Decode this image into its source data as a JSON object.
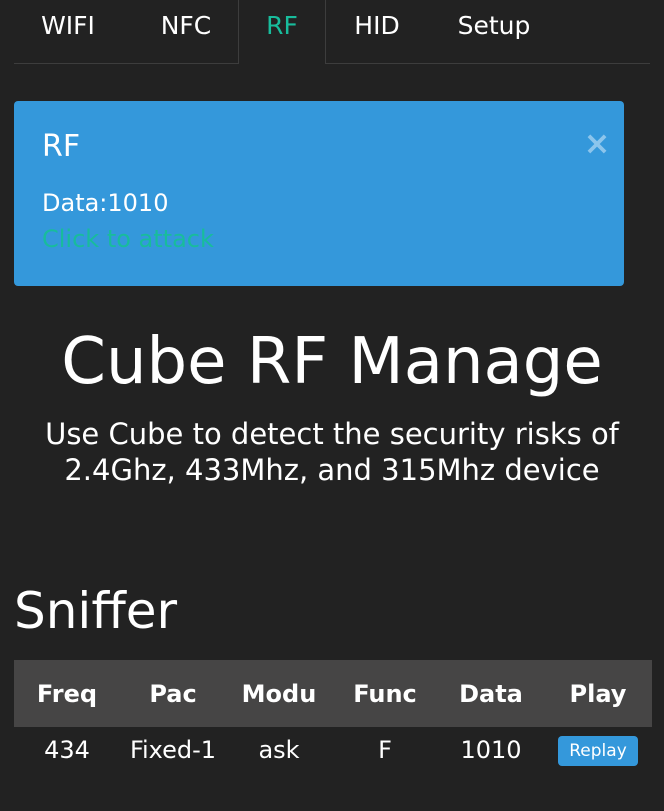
{
  "tabs": {
    "wifi": "WIFI",
    "nfc": "NFC",
    "rf": "RF",
    "hid": "HID",
    "setup": "Setup",
    "active": "RF"
  },
  "alert": {
    "title": "RF",
    "close": "×",
    "data": "Data:1010",
    "link": "Click to attack"
  },
  "hero": {
    "title": "Cube RF Manage",
    "subtitle_line1": "Use Cube to detect the security risks of",
    "subtitle_line2": "2.4Ghz, 433Mhz, and 315Mhz device"
  },
  "sniffer": {
    "title": "Sniffer",
    "headers": [
      "Freq",
      "Pac",
      "Modu",
      "Func",
      "Data",
      "Play"
    ],
    "rows": [
      {
        "freq": "434",
        "pac": "Fixed-1",
        "modu": "ask",
        "func": "F",
        "data": "1010",
        "play": "Replay"
      }
    ]
  },
  "colors": {
    "background": "#222222",
    "alert": "#3498db",
    "accent": "#18bc9c",
    "table_header": "#464545"
  }
}
